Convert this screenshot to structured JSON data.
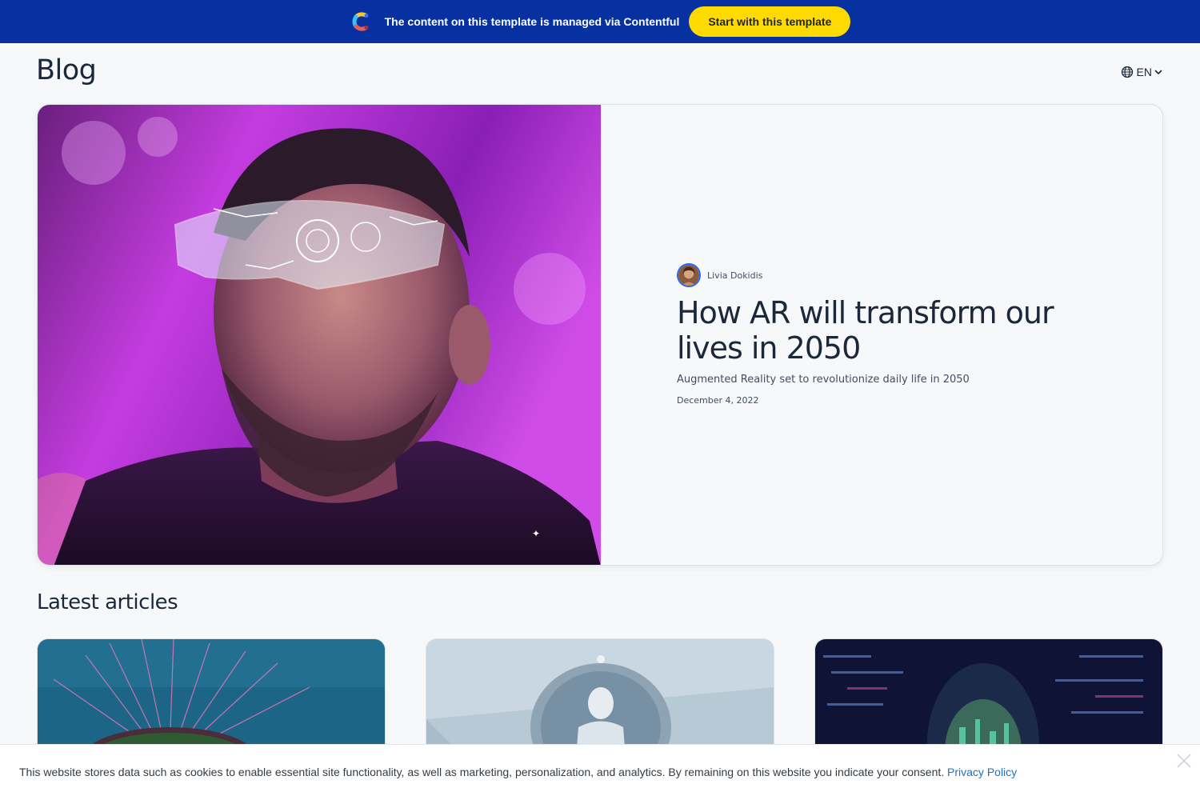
{
  "banner": {
    "text": "The content on this template is managed via Contentful",
    "cta_label": "Start with this template",
    "logo_icon": "contentful-logo-icon"
  },
  "header": {
    "title": "Blog",
    "language": "EN",
    "language_icon": "globe-icon"
  },
  "hero": {
    "author_name": "Livia Dokidis",
    "title": "How AR will transform our lives in 2050",
    "subtitle": "Augmented Reality set to revolutionize daily life in 2050",
    "date": "December 4, 2022"
  },
  "latest": {
    "heading": "Latest articles"
  },
  "cookie": {
    "text": "This website stores data such as cookies to enable essential site functionality, as well as marketing, personalization, and analytics. By remaining on this website you indicate your consent.",
    "link_label": "Privacy Policy"
  },
  "colors": {
    "banner_bg": "#0731a1",
    "cta_bg": "#ffda00",
    "text_dark": "#1b273a",
    "link": "#1a73c8"
  }
}
